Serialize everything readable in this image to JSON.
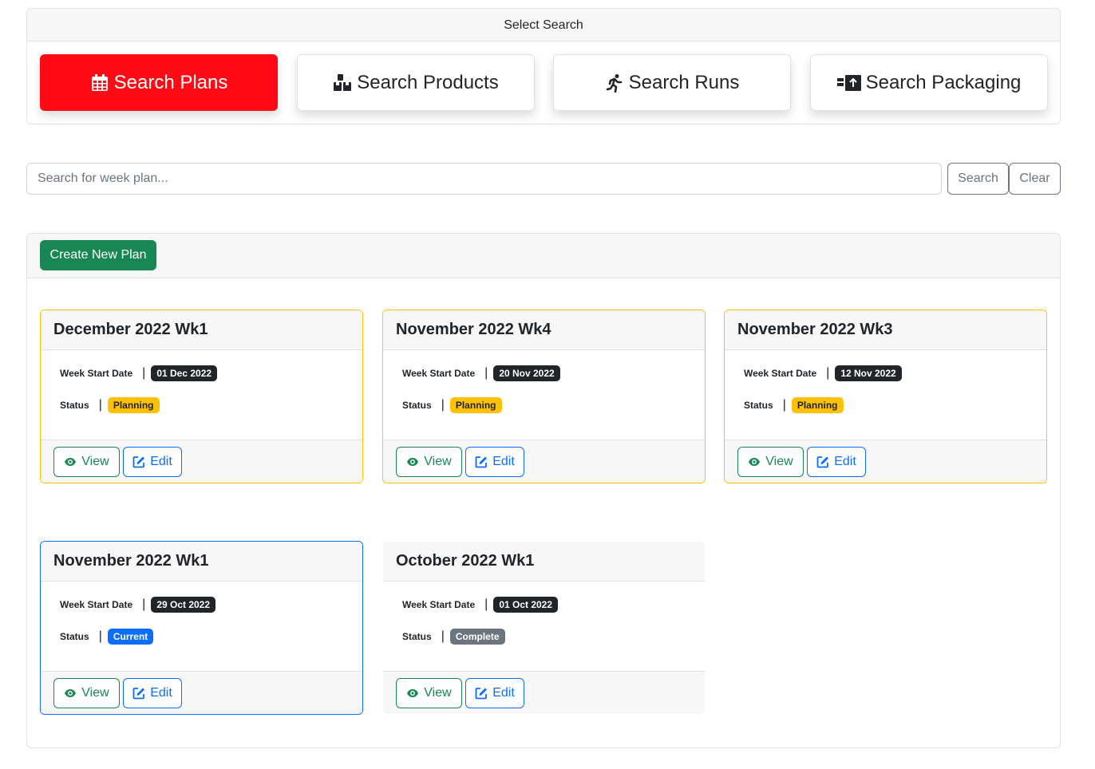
{
  "select_search": {
    "title": "Select Search",
    "tabs": [
      {
        "label": "Search Plans",
        "icon": "calendar-icon",
        "active": true
      },
      {
        "label": "Search Products",
        "icon": "boxes-icon",
        "active": false
      },
      {
        "label": "Search Runs",
        "icon": "running-person-icon",
        "active": false
      },
      {
        "label": "Search Packaging",
        "icon": "truck-loading-icon",
        "active": false
      }
    ]
  },
  "search": {
    "placeholder": "Search for week plan...",
    "value": "",
    "search_label": "Search",
    "clear_label": "Clear"
  },
  "plans": {
    "create_label": "Create New Plan",
    "week_start_label": "Week Start Date",
    "status_label": "Status",
    "view_label": "View",
    "edit_label": "Edit",
    "items": [
      {
        "title": "December 2022 Wk1",
        "week_start": "01 Dec 2022",
        "status": "Planning"
      },
      {
        "title": "November 2022 Wk4",
        "week_start": "20 Nov 2022",
        "status": "Planning"
      },
      {
        "title": "November 2022 Wk3",
        "week_start": "12 Nov 2022",
        "status": "Planning"
      },
      {
        "title": "November 2022 Wk1",
        "week_start": "29 Oct 2022",
        "status": "Current"
      },
      {
        "title": "October 2022 Wk1",
        "week_start": "01 Oct 2022",
        "status": "Complete"
      }
    ]
  },
  "colors": {
    "active_tab": "#ff0a15",
    "create_button": "#198754",
    "planning_badge": "#ffc107",
    "current_badge": "#0d6efd",
    "complete_badge": "#6c757d",
    "date_badge": "#212529"
  }
}
